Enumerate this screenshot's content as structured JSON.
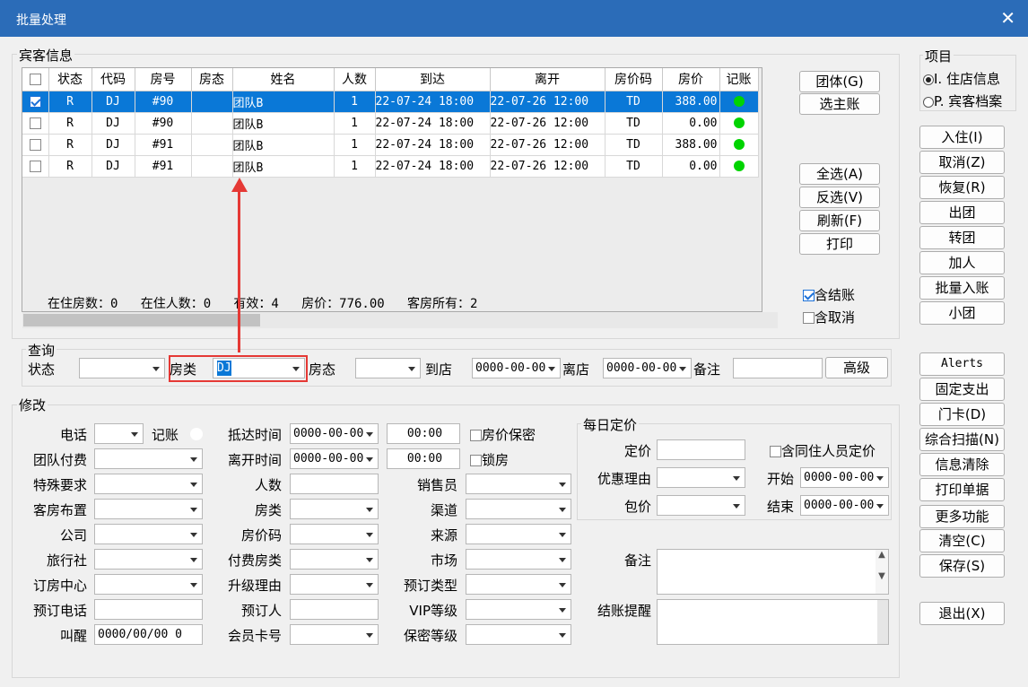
{
  "window": {
    "title": "批量处理",
    "close": "✕"
  },
  "guest_info": {
    "label": "宾客信息",
    "columns": [
      "",
      "状态",
      "代码",
      "房号",
      "房态",
      "姓名",
      "人数",
      "到达",
      "离开",
      "房价码",
      "房价",
      "记账"
    ],
    "rows": [
      {
        "checked": true,
        "status": "R",
        "code": "DJ",
        "room": "#90",
        "room_status": "",
        "name": "团队B",
        "persons": "1",
        "arrive": "22-07-24 18:00",
        "depart": "22-07-26 12:00",
        "rate_code": "TD",
        "rate": "388.00",
        "posting": "green"
      },
      {
        "checked": false,
        "status": "R",
        "code": "DJ",
        "room": "#90",
        "room_status": "",
        "name": "团队B",
        "persons": "1",
        "arrive": "22-07-24 18:00",
        "depart": "22-07-26 12:00",
        "rate_code": "TD",
        "rate": "0.00",
        "posting": "green"
      },
      {
        "checked": false,
        "status": "R",
        "code": "DJ",
        "room": "#91",
        "room_status": "",
        "name": "团队B",
        "persons": "1",
        "arrive": "22-07-24 18:00",
        "depart": "22-07-26 12:00",
        "rate_code": "TD",
        "rate": "388.00",
        "posting": "green"
      },
      {
        "checked": false,
        "status": "R",
        "code": "DJ",
        "room": "#91",
        "room_status": "",
        "name": "团队B",
        "persons": "1",
        "arrive": "22-07-24 18:00",
        "depart": "22-07-26 12:00",
        "rate_code": "TD",
        "rate": "0.00",
        "posting": "green"
      }
    ],
    "summary": "在住房数：0   在住人数：0   有效：4   房价：776.00   客房所有：2"
  },
  "grid_buttons": {
    "group": "团体(G)",
    "select_master": "选主账",
    "select_all": "全选(A)",
    "invert": "反选(V)",
    "refresh": "刷新(F)",
    "print": "打印"
  },
  "checks": {
    "include_settled": "含结账",
    "include_cancelled": "含取消"
  },
  "query": {
    "label": "查询",
    "status_label": "状态",
    "status_value": "",
    "room_type_label": "房类",
    "room_type_value": "DJ",
    "room_state_label": "房态",
    "room_state_value": "",
    "arrive_label": "到店",
    "arrive_value": "0000-00-00",
    "depart_label": "离店",
    "depart_value": "0000-00-00",
    "remark_label": "备注",
    "remark_value": "",
    "advanced": "高级"
  },
  "modify": {
    "label": "修改",
    "phone": "电话",
    "posting": "记账",
    "team_payment": "团队付费",
    "special": "特殊要求",
    "room_layout": "客房布置",
    "company": "公司",
    "agency": "旅行社",
    "booking_center": "订房中心",
    "booking_phone": "预订电话",
    "wakeup": "叫醒",
    "wakeup_value": "0000/00/00 0",
    "arrive_time": "抵达时间",
    "arrive_date": "0000-00-00",
    "arrive_clock": "00:00",
    "depart_time": "离开时间",
    "depart_date": "0000-00-00",
    "depart_clock": "00:00",
    "persons": "人数",
    "room_type": "房类",
    "rate_code": "房价码",
    "pay_room_type": "付费房类",
    "upgrade": "升级理由",
    "booker": "预订人",
    "member_card": "会员卡号",
    "secret_rate": "房价保密",
    "lock_room": "锁房",
    "sales": "销售员",
    "channel": "渠道",
    "source": "来源",
    "market": "市场",
    "booking_type": "预订类型",
    "vip": "VIP等级",
    "secrecy": "保密等级",
    "remark": "备注",
    "checkout_reminder": "结账提醒"
  },
  "daily_rate": {
    "label": "每日定价",
    "price": "定价",
    "include_cohabitants": "含同住人员定价",
    "discount_reason": "优惠理由",
    "start": "开始",
    "start_value": "0000-00-00",
    "package": "包价",
    "end": "结束",
    "end_value": "0000-00-00"
  },
  "project": {
    "label": "项目",
    "opt1": "I. 住店信息",
    "opt2": "P. 宾客档案"
  },
  "side_buttons": [
    "入住(I)",
    "取消(Z)",
    "恢复(R)",
    "出团",
    "转团",
    "加人",
    "批量入账",
    "小团"
  ],
  "side_buttons2": [
    "Alerts",
    "固定支出",
    "门卡(D)",
    "综合扫描(N)",
    "信息清除",
    "打印单据",
    "更多功能",
    "清空(C)",
    "保存(S)"
  ],
  "exit": "退出(X)",
  "colors": {
    "title_bar": "#2b6cb8",
    "selection": "#0a78d7",
    "annotation": "#e53935",
    "posting_dot": "#00d400"
  }
}
